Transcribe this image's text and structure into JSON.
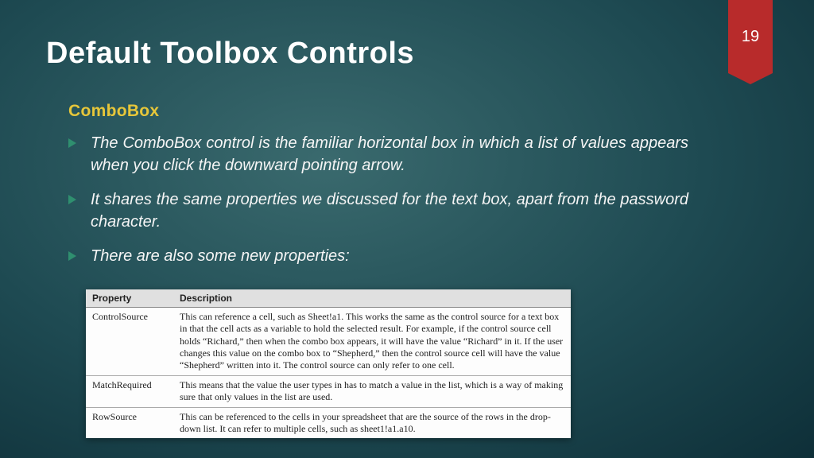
{
  "slide_number": "19",
  "title": "Default Toolbox Controls",
  "subhead": "ComboBox",
  "bullets": [
    "The ComboBox control is the familiar horizontal box in which a list of values appears when you click the downward pointing arrow.",
    "It shares the same properties we discussed for the text box, apart from the password character.",
    "There are also some new properties:"
  ],
  "table": {
    "headers": [
      "Property",
      "Description"
    ],
    "rows": [
      {
        "property": "ControlSource",
        "description": "This can reference a cell, such as Sheet!a1. This works the same as the control source for a text box in that the cell acts as a variable to hold the selected result. For example, if the control source cell holds “Richard,” then when the combo box appears, it will have the value “Richard” in it. If the user changes this value on the combo box to “Shepherd,” then the control source cell will have the value “Shepherd” written into it. The control source can only refer to one cell."
      },
      {
        "property": "MatchRequired",
        "description": "This means that the value the user types in has to match a value in the list, which is a way of making sure that only values in the list are used."
      },
      {
        "property": "RowSource",
        "description": "This can be referenced to the cells in your spreadsheet that are the source of the rows in the drop-down list. It can refer to multiple cells, such as sheet1!a1.a10."
      }
    ]
  }
}
